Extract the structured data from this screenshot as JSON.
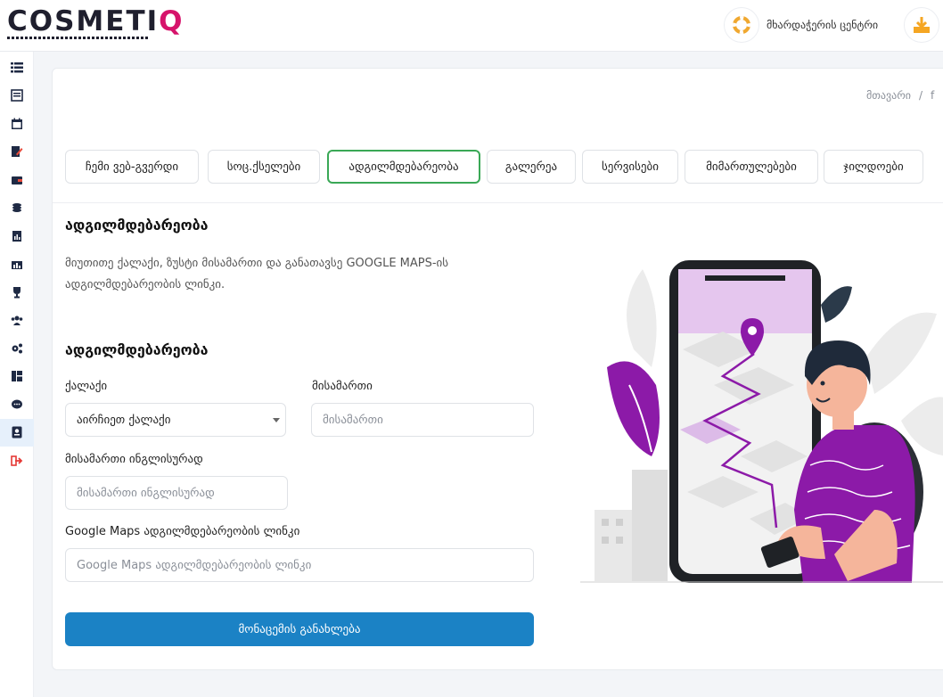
{
  "brand": {
    "logo_main": "COSMETI",
    "logo_q": "Q",
    "colors": {
      "accent_pink": "#d6136b",
      "primary_blue": "#1b82c5",
      "active_green": "#3aa856",
      "illustration_purple": "#8c1aa8"
    }
  },
  "header": {
    "support_label": "მხარდაჭერის ცენტრი",
    "support_icon": "lifebuoy-icon",
    "download_icon": "download-icon"
  },
  "sidebar": {
    "items": [
      {
        "icon": "list-icon"
      },
      {
        "icon": "table-icon"
      },
      {
        "icon": "calendar-icon"
      },
      {
        "icon": "edit-document-icon"
      },
      {
        "icon": "wallet-icon"
      },
      {
        "icon": "coins-icon"
      },
      {
        "icon": "report-icon"
      },
      {
        "icon": "chart-icon"
      },
      {
        "icon": "trophy-icon"
      },
      {
        "icon": "users-icon"
      },
      {
        "icon": "settings-icon"
      },
      {
        "icon": "layout-icon"
      },
      {
        "icon": "chat-icon"
      },
      {
        "icon": "profile-card-icon",
        "active": true
      },
      {
        "icon": "logout-icon"
      }
    ]
  },
  "breadcrumb": {
    "home": "მთავარი",
    "separator": "/",
    "current": "f"
  },
  "tabs": [
    {
      "label": "ჩემი ვებ-გვერდი"
    },
    {
      "label": "სოც.ქსელები"
    },
    {
      "label": "ადგილმდებარეობა",
      "active": true
    },
    {
      "label": "გალერეა"
    },
    {
      "label": "სერვისები"
    },
    {
      "label": "მიმართულებები"
    },
    {
      "label": "ჯილდოები"
    }
  ],
  "intro": {
    "title": "ადგილმდებარეობა",
    "description": "მიუთითე ქალაქი, ზუსტი მისამართი და განათავსე GOOGLE MAPS-ის ადგილმდებარეობის ლინკი."
  },
  "form": {
    "title": "ადგილმდებარეობა",
    "city_label": "ქალაქი",
    "city_value": "აირჩიეთ ქალაქი",
    "address_label": "მისამართი",
    "address_placeholder": "მისამართი",
    "address_en_label": "მისამართი ინგლისურად",
    "address_en_placeholder": "მისამართი ინგლისურად",
    "maps_label": "Google Maps ადგილმდებარეობის ლინკი",
    "maps_placeholder": "Google Maps ადგილმდებარეობის ლინკი",
    "submit_label": "მონაცემის განახლება"
  }
}
